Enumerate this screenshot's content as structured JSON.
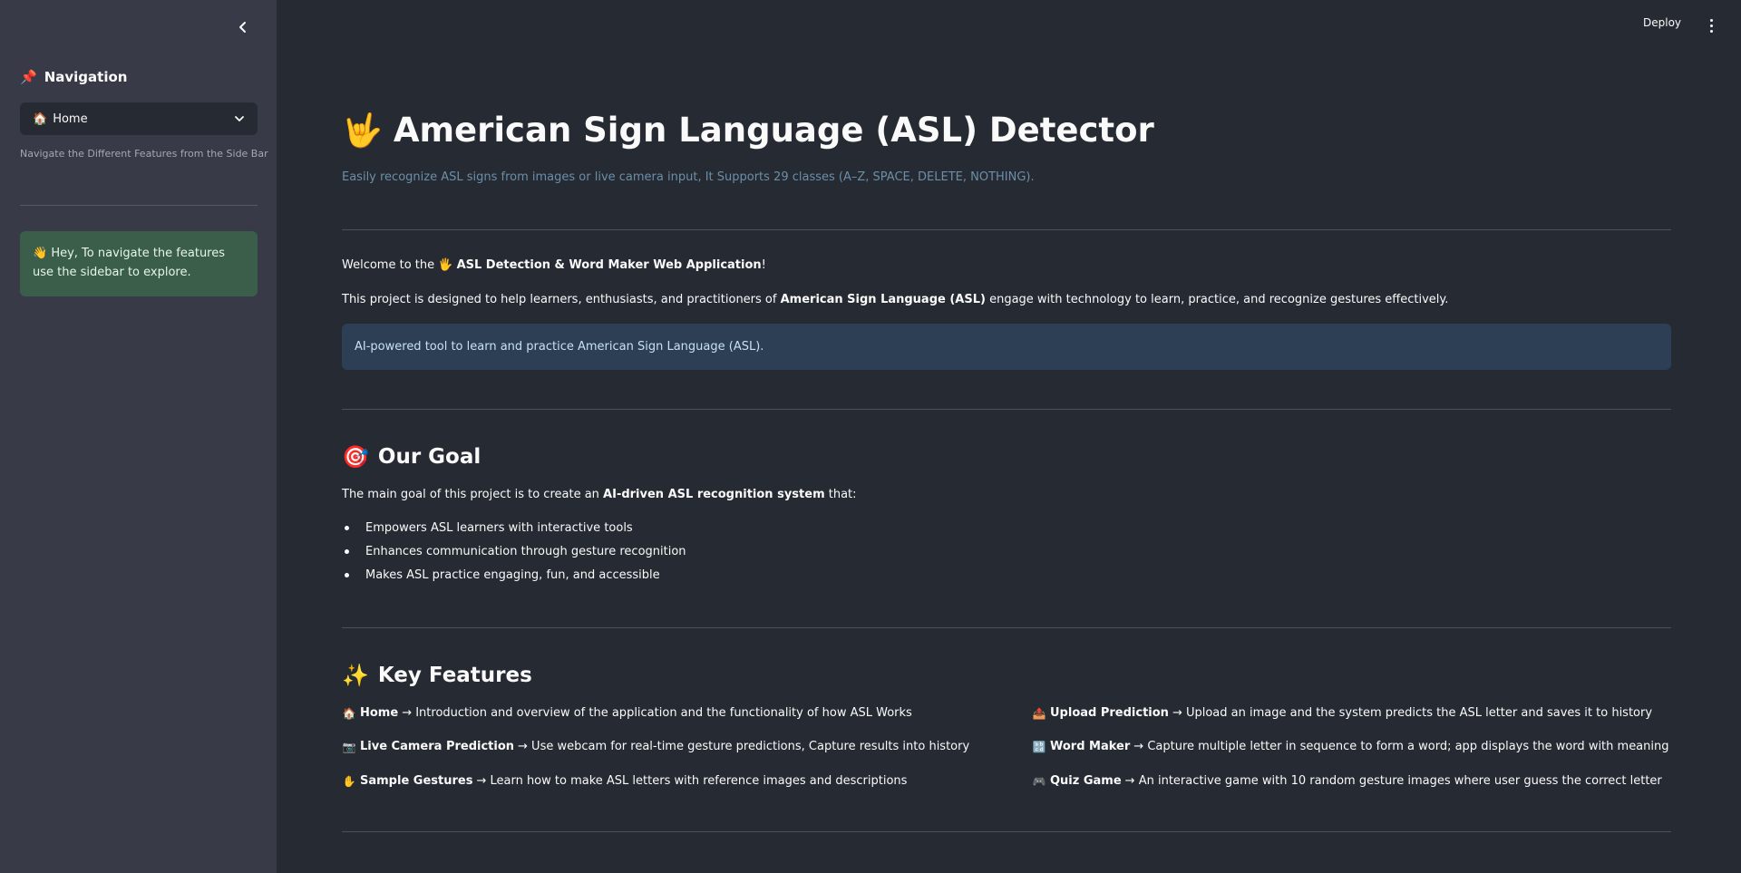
{
  "toolbar": {
    "deploy_label": "Deploy",
    "collapse_icon": "chevron-left-icon",
    "menu_icon": "kebab-menu-icon"
  },
  "sidebar": {
    "nav_icon": "📌",
    "nav_title": "Navigation",
    "select": {
      "icon": "🏠",
      "value": "Home",
      "chevron_icon": "chevron-down-icon"
    },
    "hint": "Navigate the Different Features from the Side Bar",
    "success_icon": "👋",
    "success_text": "Hey, To navigate the features use the sidebar to explore.",
    "success_color": "#3b5e4a"
  },
  "main": {
    "title_emoji": "🤟",
    "title": "American Sign Language (ASL) Detector",
    "subtitle": "Easily recognize ASL signs from images or live camera input, It Supports 29 classes (A–Z, SPACE, DELETE, NOTHING).",
    "welcome": {
      "prefix": "Welcome to the ",
      "emoji": "🖐",
      "bold": "ASL Detection & Word Maker Web Application",
      "suffix": "!"
    },
    "project": {
      "prefix": "This project is designed to help learners, enthusiasts, and practitioners of ",
      "bold": "American Sign Language (ASL)",
      "suffix": " engage with technology to learn, practice, and recognize gestures effectively."
    },
    "info": "AI-powered tool to learn and practice American Sign Language (ASL).",
    "goal": {
      "emoji": "🎯",
      "heading": "Our Goal",
      "intro_prefix": "The main goal of this project is to create an ",
      "intro_bold": "AI-driven ASL recognition system",
      "intro_suffix": " that:",
      "bullets": [
        "Empowers ASL learners with interactive tools",
        "Enhances communication through gesture recognition",
        "Makes ASL practice engaging, fun, and accessible"
      ]
    },
    "features": {
      "emoji": "✨",
      "heading": "Key Features",
      "items": [
        {
          "icon": "🏠",
          "name": "Home",
          "desc": "→ Introduction and overview of the application and the functionality of how ASL Works"
        },
        {
          "icon": "📤",
          "name": "Upload Prediction",
          "desc": "→ Upload an image and the system predicts the ASL letter and saves it to history"
        },
        {
          "icon": "📷",
          "name": "Live Camera Prediction",
          "desc": "→ Use webcam for real-time gesture predictions, Capture results into history"
        },
        {
          "icon": "🔡",
          "name": "Word Maker",
          "desc": "→ Capture multiple letter in sequence to form a word; app displays the word with meaning"
        },
        {
          "icon": "✋",
          "name": "Sample Gestures",
          "desc": "→ Learn how to make ASL letters with reference images and descriptions"
        },
        {
          "icon": "🎮",
          "name": "Quiz Game",
          "desc": "→ An interactive game with 10 random gesture images where user guess the correct letter"
        }
      ]
    }
  }
}
